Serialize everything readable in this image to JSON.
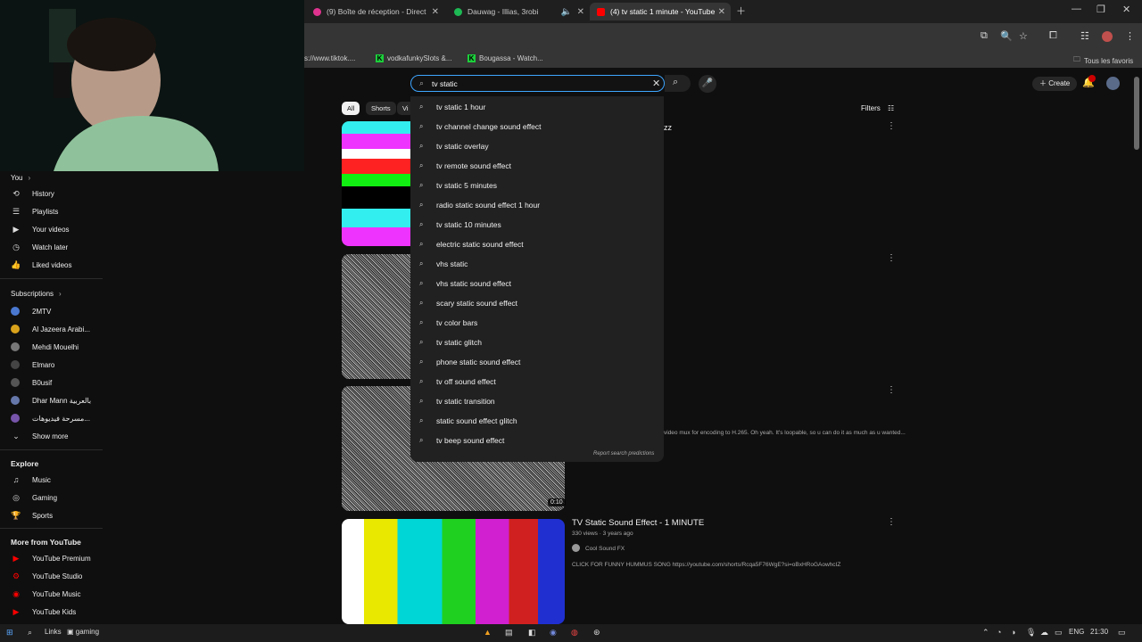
{
  "browser": {
    "tabs": [
      {
        "title": "(9) Boîte de réception - Direct",
        "color": "#e0338f"
      },
      {
        "title": "Dauwag - Illias, 3robi",
        "color": "#1db954"
      },
      {
        "title": "(4) tv static 1 minute - YouTube",
        "color": "#ff0000"
      }
    ],
    "bookmarks": [
      {
        "label": "s://www.tiktok...."
      },
      {
        "label": "vodkafunkySlots &...",
        "badge": "K"
      },
      {
        "label": "Bougassa - Watch...",
        "badge": "K"
      }
    ],
    "bookmarks_folder": "Tous les favoris"
  },
  "sidebar": {
    "you_label": "You",
    "you_items": [
      {
        "label": "History",
        "icon": "history-icon",
        "glyph": "⟲"
      },
      {
        "label": "Playlists",
        "icon": "playlists-icon",
        "glyph": "☰"
      },
      {
        "label": "Your videos",
        "icon": "your-videos-icon",
        "glyph": "▶"
      },
      {
        "label": "Watch later",
        "icon": "watch-later-icon",
        "glyph": "◷"
      },
      {
        "label": "Liked videos",
        "icon": "liked-icon",
        "glyph": "👍"
      }
    ],
    "subscriptions_label": "Subscriptions",
    "subscriptions": [
      {
        "label": "2MTV",
        "color": "#4a78d0"
      },
      {
        "label": "Al Jazeera Arabi...",
        "color": "#d9a21b"
      },
      {
        "label": "Mehdi Mouelhi",
        "color": "#777"
      },
      {
        "label": "Elmaro",
        "color": "#444"
      },
      {
        "label": "B0usif",
        "color": "#555"
      },
      {
        "label": "Dhar Mann بالعربية",
        "color": "#6677aa"
      },
      {
        "label": "مسرحة فيديوهات...",
        "color": "#7755aa"
      }
    ],
    "show_more": "Show more",
    "explore_label": "Explore",
    "explore": [
      {
        "label": "Music",
        "icon": "music-icon",
        "glyph": "♫"
      },
      {
        "label": "Gaming",
        "icon": "gaming-icon",
        "glyph": "◎"
      },
      {
        "label": "Sports",
        "icon": "sports-icon",
        "glyph": "🏆"
      }
    ],
    "more_label": "More from YouTube",
    "more": [
      {
        "label": "YouTube Premium"
      },
      {
        "label": "YouTube Studio"
      },
      {
        "label": "YouTube Music"
      },
      {
        "label": "YouTube Kids"
      }
    ]
  },
  "header": {
    "search_value": "tv static",
    "create_label": "Create",
    "filters_label": "Filters"
  },
  "chips": [
    {
      "label": "All"
    },
    {
      "label": "Shorts"
    },
    {
      "label": "Vi"
    }
  ],
  "suggestions": [
    "tv static 1 hour",
    "tv channel change sound effect",
    "tv static overlay",
    "tv remote sound effect",
    "tv static 5 minutes",
    "radio static sound effect 1 hour",
    "tv static 10 minutes",
    "electric static sound effect",
    "vhs static",
    "vhs static sound effect",
    "scary static sound effect",
    "tv color bars",
    "tv static glitch",
    "phone static sound effect",
    "tv off sound effect",
    "tv static transition",
    "static sound effect glitch",
    "tv beep sound effect"
  ],
  "report_label": "Report search predictions",
  "results": {
    "r1_title_fragment": "zz",
    "r3_desc": "video mux for encoding to H.265. Oh yeah. It's loopable, so u can do it as much as u wanted...",
    "r3_duration": "0:10",
    "r4_title": "TV Static Sound Effect - 1 MINUTE",
    "r4_meta": "330 views · 3 years ago",
    "r4_channel": "Cool Sound FX",
    "r4_desc": "CLICK FOR FUNNY HUMMUS SONG https://youtube.com/shorts/Rcqa5F76WgE?si=oBxHRoGAowhcIZ"
  },
  "taskbar": {
    "search_label": "Links",
    "app_label": "gaming",
    "lang": "ENG",
    "time": "21:30"
  }
}
